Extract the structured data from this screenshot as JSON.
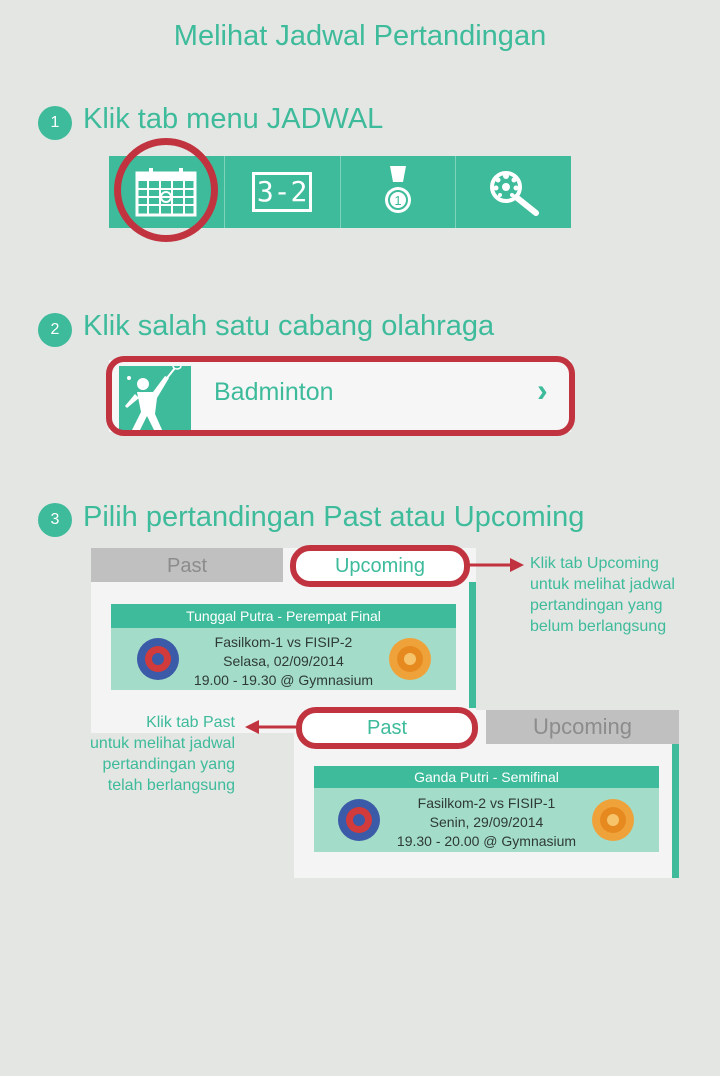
{
  "title": "Melihat Jadwal Pertandingan",
  "steps": [
    {
      "num": "1",
      "text": "Klik tab menu JADWAL"
    },
    {
      "num": "2",
      "text": "Klik salah satu cabang olahraga"
    },
    {
      "num": "3",
      "text": "Pilih pertandingan Past atau Upcoming"
    }
  ],
  "tabbar": {
    "icons": [
      "calendar-icon",
      "scoreboard-icon",
      "medal-icon",
      "search-logo-icon"
    ],
    "score_text": "3-2",
    "medal_text": "1"
  },
  "sport": {
    "label": "Badminton",
    "chevron": "›",
    "icon": "badminton-player-icon"
  },
  "example_upcoming": {
    "tab_past": "Past",
    "tab_upcoming": "Upcoming",
    "card_header": "Tunggal Putra - Perempat Final",
    "match": "Fasilkom-1 vs FISIP-2",
    "date": "Selasa, 02/09/2014",
    "time": "19.00 - 19.30 @ Gymnasium",
    "note": [
      "Klik tab Upcoming",
      "untuk melihat jadwal",
      "pertandingan yang",
      "belum berlangsung"
    ]
  },
  "example_past": {
    "tab_past": "Past",
    "tab_upcoming": "Upcoming",
    "card_header": "Ganda Putri - Semifinal",
    "match": "Fasilkom-2 vs FISIP-1",
    "date": "Senin, 29/09/2014",
    "time": "19.30 - 20.00 @ Gymnasium",
    "note": [
      "Klik tab Past",
      "untuk melihat jadwal",
      "pertandingan yang",
      "telah berlangsung"
    ]
  },
  "colors": {
    "accent": "#3dbb9b",
    "highlight": "#c0333f",
    "background": "#e4e6e3",
    "card_body": "#a3dcc8"
  }
}
